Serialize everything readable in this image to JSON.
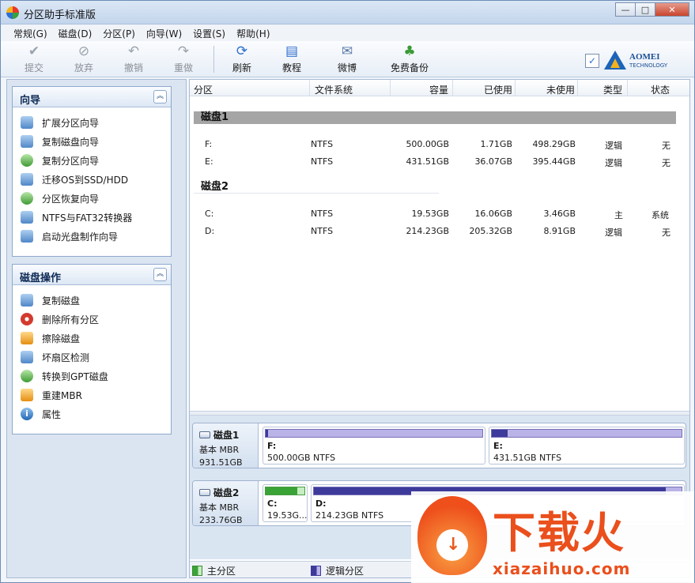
{
  "window": {
    "title": "分区助手标准版",
    "controls": [
      "—",
      "□",
      "✕"
    ]
  },
  "menu": [
    {
      "label": "常规(G)"
    },
    {
      "label": "磁盘(D)"
    },
    {
      "label": "分区(P)"
    },
    {
      "label": "向导(W)"
    },
    {
      "label": "设置(S)"
    },
    {
      "label": "帮助(H)"
    }
  ],
  "toolbar": {
    "items": [
      {
        "label": "提交",
        "icon": "check-icon",
        "glyph": "✔",
        "enabled": false
      },
      {
        "label": "放弃",
        "icon": "discard-icon",
        "glyph": "⊘",
        "enabled": false
      },
      {
        "label": "撤销",
        "icon": "undo-icon",
        "glyph": "↶",
        "enabled": false
      },
      {
        "label": "重做",
        "icon": "redo-icon",
        "glyph": "↷",
        "enabled": false
      },
      {
        "label": "刷新",
        "icon": "refresh-icon",
        "glyph": "⟳",
        "enabled": true
      },
      {
        "label": "教程",
        "icon": "book-icon",
        "glyph": "▤",
        "enabled": true
      },
      {
        "label": "微博",
        "icon": "weibo-icon",
        "glyph": "✉",
        "enabled": true
      },
      {
        "label": "免费备份",
        "icon": "backup-icon",
        "glyph": "♣",
        "enabled": true
      }
    ],
    "brand": {
      "name": "AOMEI",
      "sub": "TECHNOLOGY"
    }
  },
  "wizard_group": {
    "title": "向导",
    "items": [
      {
        "label": "扩展分区向导",
        "icon": "extend-partition-icon"
      },
      {
        "label": "复制磁盘向导",
        "icon": "copy-disk-icon"
      },
      {
        "label": "复制分区向导",
        "icon": "copy-partition-icon"
      },
      {
        "label": "迁移OS到SSD/HDD",
        "icon": "migrate-os-icon"
      },
      {
        "label": "分区恢复向导",
        "icon": "partition-recovery-icon"
      },
      {
        "label": "NTFS与FAT32转换器",
        "icon": "ntfs-fat32-converter-icon"
      },
      {
        "label": "启动光盘制作向导",
        "icon": "bootable-cd-icon"
      }
    ]
  },
  "disk_ops_group": {
    "title": "磁盘操作",
    "items": [
      {
        "label": "复制磁盘",
        "icon": "copy-disk-icon"
      },
      {
        "label": "删除所有分区",
        "icon": "delete-all-partitions-icon"
      },
      {
        "label": "擦除磁盘",
        "icon": "wipe-disk-icon"
      },
      {
        "label": "坏扇区检测",
        "icon": "bad-sector-check-icon"
      },
      {
        "label": "转换到GPT磁盘",
        "icon": "convert-gpt-icon"
      },
      {
        "label": "重建MBR",
        "icon": "rebuild-mbr-icon"
      },
      {
        "label": "属性",
        "icon": "info-icon"
      }
    ]
  },
  "columns": [
    "分区",
    "文件系统",
    "容量",
    "已使用",
    "未使用",
    "类型",
    "状态"
  ],
  "disks": [
    {
      "name": "磁盘1",
      "rows": [
        {
          "partition": "F:",
          "fs": "NTFS",
          "capacity": "500.00GB",
          "used": "1.71GB",
          "unused": "498.29GB",
          "type": "逻辑",
          "status": "无"
        },
        {
          "partition": "E:",
          "fs": "NTFS",
          "capacity": "431.51GB",
          "used": "36.07GB",
          "unused": "395.44GB",
          "type": "逻辑",
          "status": "无"
        }
      ]
    },
    {
      "name": "磁盘2",
      "rows": [
        {
          "partition": "C:",
          "fs": "NTFS",
          "capacity": "19.53GB",
          "used": "16.06GB",
          "unused": "3.46GB",
          "type": "主",
          "status": "系统"
        },
        {
          "partition": "D:",
          "fs": "NTFS",
          "capacity": "214.23GB",
          "used": "205.32GB",
          "unused": "8.91GB",
          "type": "逻辑",
          "status": "无"
        }
      ]
    }
  ],
  "disk_map": [
    {
      "name": "磁盘1",
      "kind": "基本 MBR",
      "size": "931.51GB",
      "partitions": [
        {
          "label": "F:",
          "info": "500.00GB NTFS",
          "used_fraction": 0.003,
          "kind": "logical"
        },
        {
          "label": "E:",
          "info": "431.51GB NTFS",
          "used_fraction": 0.084,
          "kind": "logical"
        }
      ]
    },
    {
      "name": "磁盘2",
      "kind": "基本 MBR",
      "size": "233.76GB",
      "partitions": [
        {
          "label": "C:",
          "info": "19.53G...",
          "used_fraction": 0.82,
          "kind": "primary"
        },
        {
          "label": "D:",
          "info": "214.23GB NTFS",
          "used_fraction": 0.958,
          "kind": "logical"
        }
      ]
    }
  ],
  "legend": {
    "primary": "主分区",
    "logical": "逻辑分区"
  },
  "watermark": {
    "brand": "下载火",
    "url": "xiazaihuo.com"
  }
}
